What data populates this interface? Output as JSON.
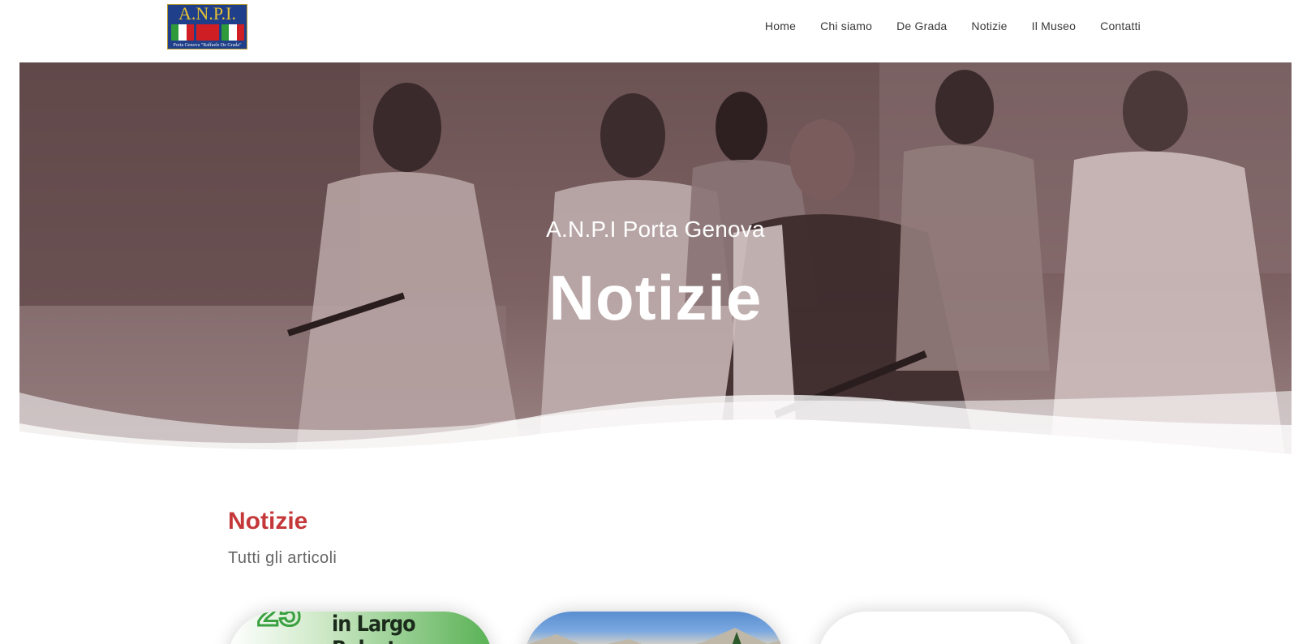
{
  "logo": {
    "title": "A.N.P.I.",
    "subtitle": "Porta Genova \"Raffaele De Grada\""
  },
  "nav": {
    "items": [
      "Home",
      "Chi siamo",
      "De Grada",
      "Notizie",
      "Il Museo",
      "Contatti"
    ]
  },
  "hero": {
    "subtitle": "A.N.P.I Porta Genova",
    "title": "Notizie"
  },
  "section": {
    "title": "Notizie",
    "subtitle": "Tutti gli articoli"
  },
  "cards": [
    {
      "caption": "in Largo Balestra",
      "number": "25"
    },
    {
      "caption": ""
    },
    {
      "caption": ""
    }
  ],
  "colors": {
    "accent": "#c5383a",
    "hero_tint": "#5b4546",
    "nav_text": "#3a3a3a"
  }
}
